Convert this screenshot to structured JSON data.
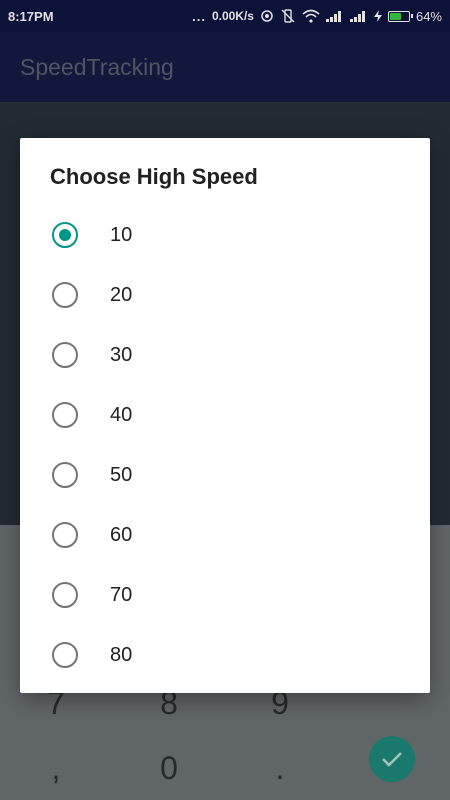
{
  "status_bar": {
    "time": "8:17PM",
    "dots": "...",
    "net_speed": "0.00K/s",
    "battery": "64%",
    "battery_level": 0.64,
    "battery_color": "#3ad14a"
  },
  "app_bar": {
    "title": "SpeedTracking"
  },
  "dialog": {
    "title": "Choose High Speed",
    "options": [
      {
        "label": "10",
        "checked": true
      },
      {
        "label": "20",
        "checked": false
      },
      {
        "label": "30",
        "checked": false
      },
      {
        "label": "40",
        "checked": false
      },
      {
        "label": "50",
        "checked": false
      },
      {
        "label": "60",
        "checked": false
      },
      {
        "label": "70",
        "checked": false
      },
      {
        "label": "80",
        "checked": false
      }
    ],
    "accent_color": "#009688"
  },
  "keypad": {
    "row1": [
      "7",
      "8",
      "9"
    ],
    "row2": [
      ",",
      "0",
      "."
    ]
  }
}
